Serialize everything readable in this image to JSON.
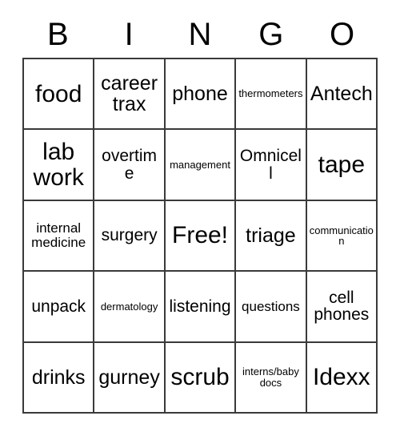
{
  "card": {
    "title": "BINGO Card",
    "headers": [
      "B",
      "I",
      "N",
      "G",
      "O"
    ],
    "rows": [
      [
        {
          "text": "food",
          "size": "sz-xl"
        },
        {
          "text": "career\ntrax",
          "size": "sz-lg"
        },
        {
          "text": "phone",
          "size": "sz-lg"
        },
        {
          "text": "thermometers",
          "size": "sz-xs"
        },
        {
          "text": "Antech",
          "size": "sz-lg"
        }
      ],
      [
        {
          "text": "lab\nwork",
          "size": "sz-xl"
        },
        {
          "text": "overtime",
          "size": "sz-md"
        },
        {
          "text": "management",
          "size": "sz-xs"
        },
        {
          "text": "Omnicell",
          "size": "sz-md"
        },
        {
          "text": "tape",
          "size": "sz-xl"
        }
      ],
      [
        {
          "text": "internal\nmedicine",
          "size": "sz-sm"
        },
        {
          "text": "surgery",
          "size": "sz-md"
        },
        {
          "text": "Free!",
          "size": "sz-xl"
        },
        {
          "text": "triage",
          "size": "sz-lg"
        },
        {
          "text": "communication",
          "size": "sz-xs"
        }
      ],
      [
        {
          "text": "unpack",
          "size": "sz-md"
        },
        {
          "text": "dermatology",
          "size": "sz-xs"
        },
        {
          "text": "listening",
          "size": "sz-md"
        },
        {
          "text": "questions",
          "size": "sz-sm"
        },
        {
          "text": "cell\nphones",
          "size": "sz-md"
        }
      ],
      [
        {
          "text": "drinks",
          "size": "sz-lg"
        },
        {
          "text": "gurney",
          "size": "sz-lg"
        },
        {
          "text": "scrub",
          "size": "sz-xl"
        },
        {
          "text": "interns/baby\ndocs",
          "size": "sz-xs"
        },
        {
          "text": "Idexx",
          "size": "sz-xl"
        }
      ]
    ],
    "colors": {
      "background": "#ffffff",
      "text": "#000000",
      "border": "#3a3a3a"
    }
  }
}
